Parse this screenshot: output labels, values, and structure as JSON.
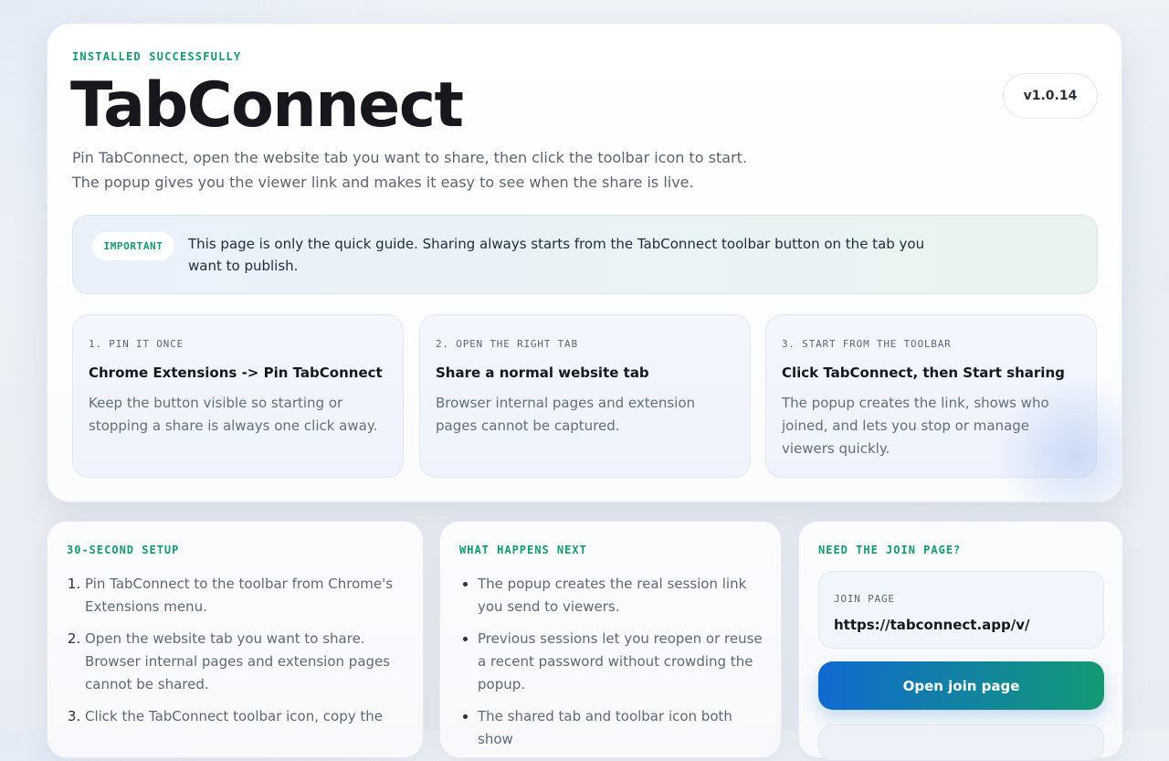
{
  "hero": {
    "eyebrow": "INSTALLED SUCCESSFULLY",
    "title": "TabConnect",
    "version": "v1.0.14",
    "lead": "Pin TabConnect, open the website tab you want to share, then click the toolbar icon to start. The popup gives you the viewer link and makes it easy to see when the share is live."
  },
  "notice": {
    "badge": "IMPORTANT",
    "text": "This page is only the quick guide. Sharing always starts from the TabConnect toolbar button on the tab you want to publish."
  },
  "steps": [
    {
      "kicker": "1. PIN IT ONCE",
      "title": "Chrome Extensions -> Pin TabConnect",
      "body": "Keep the button visible so starting or stopping a share is always one click away."
    },
    {
      "kicker": "2. OPEN THE RIGHT TAB",
      "title": "Share a normal website tab",
      "body": "Browser internal pages and extension pages cannot be captured."
    },
    {
      "kicker": "3. START FROM THE TOOLBAR",
      "title": "Click TabConnect, then Start sharing",
      "body": "The popup creates the link, shows who joined, and lets you stop or manage viewers quickly."
    }
  ],
  "setup": {
    "heading": "30-SECOND SETUP",
    "items": [
      "Pin TabConnect to the toolbar from Chrome's Extensions menu.",
      "Open the website tab you want to share. Browser internal pages and extension pages cannot be shared.",
      "Click the TabConnect toolbar icon, copy the"
    ]
  },
  "next": {
    "heading": "WHAT HAPPENS NEXT",
    "items": [
      "The popup creates the real session link you send to viewers.",
      "Previous sessions let you reopen or reuse a recent password without crowding the popup.",
      "The shared tab and toolbar icon both show"
    ]
  },
  "join": {
    "heading": "NEED THE JOIN PAGE?",
    "label": "JOIN PAGE",
    "url": "https://tabconnect.app/v/",
    "button": "Open join page"
  }
}
